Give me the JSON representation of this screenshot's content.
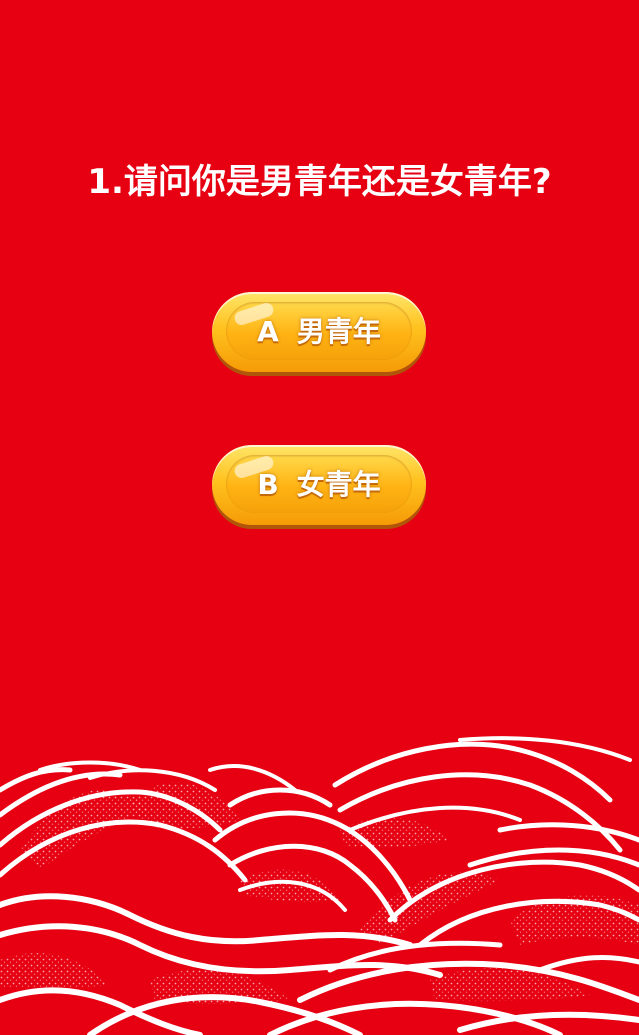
{
  "question": {
    "text": "1.请问你是男青年还是女青年?"
  },
  "options": [
    {
      "letter": "A",
      "text": "男青年"
    },
    {
      "letter": "B",
      "text": "女青年"
    }
  ],
  "colors": {
    "background": "#e60012",
    "button_gold": "#ffc21e",
    "text": "#ffffff"
  },
  "icons": {
    "decoration": "waves-decoration"
  }
}
